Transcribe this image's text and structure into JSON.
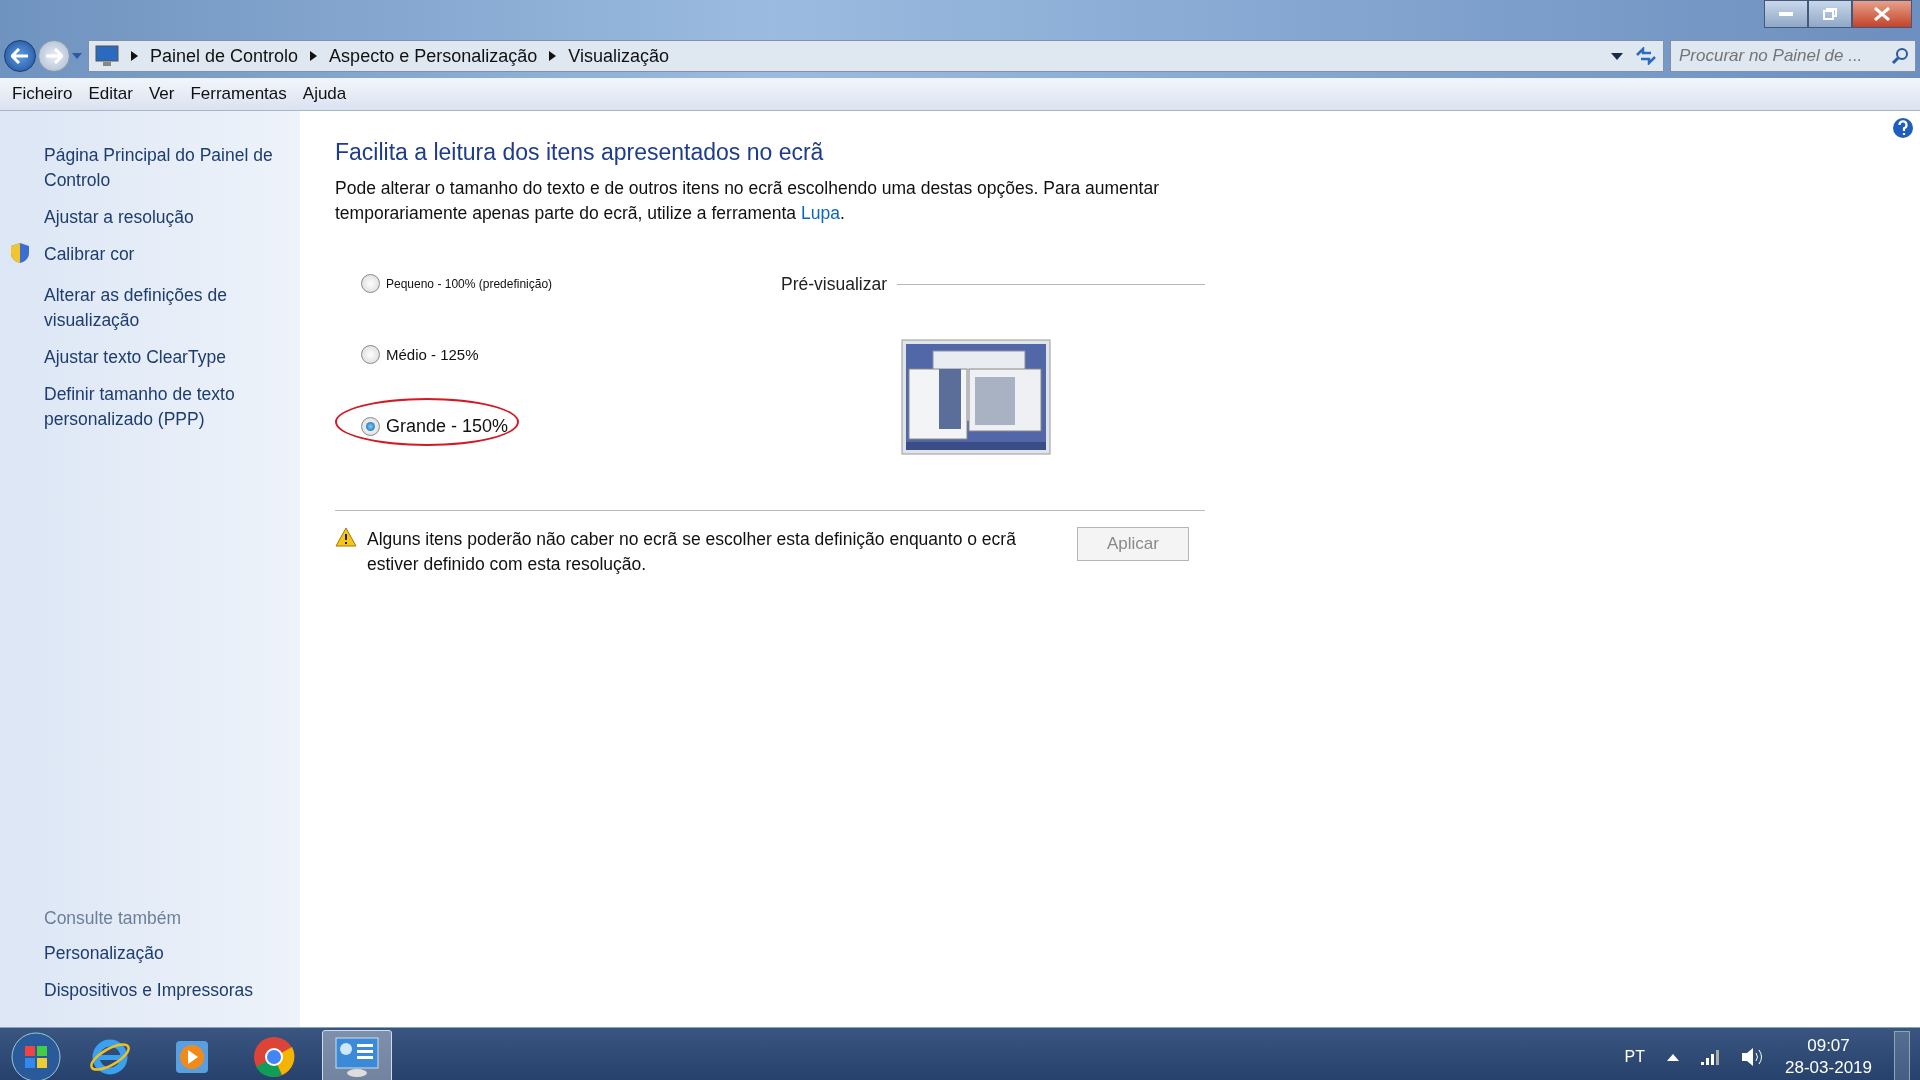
{
  "window": {
    "breadcrumb": [
      "Painel de Controlo",
      "Aspecto e Personalização",
      "Visualização"
    ],
    "search": {
      "placeholder": "Procurar no Painel de ..."
    }
  },
  "menu": [
    "Ficheiro",
    "Editar",
    "Ver",
    "Ferramentas",
    "Ajuda"
  ],
  "sidebar": {
    "items": [
      {
        "label": "Página Principal do Painel de Controlo",
        "shield": false
      },
      {
        "label": "Ajustar a resolução",
        "shield": false
      },
      {
        "label": "Calibrar cor",
        "shield": true
      },
      {
        "label": "Alterar as definições de visualização",
        "shield": false
      },
      {
        "label": "Ajustar texto ClearType",
        "shield": false
      },
      {
        "label": "Definir tamanho de texto personalizado (PPP)",
        "shield": false
      }
    ],
    "see_also": {
      "title": "Consulte também",
      "items": [
        "Personalização",
        "Dispositivos e Impressoras"
      ]
    }
  },
  "content": {
    "heading": "Facilita a leitura dos itens apresentados no ecrã",
    "description": "Pode alterar o tamanho do texto e de outros itens no ecrã escolhendo uma destas opções. Para aumentar temporariamente apenas parte do ecrã, utilize a ferramenta ",
    "link": "Lupa",
    "description_end": ".",
    "options": [
      {
        "label": "Pequeno - 100% (predefinição)",
        "kind": "small",
        "selected": false,
        "circled": false
      },
      {
        "label": "Médio - 125%",
        "kind": "medium",
        "selected": false,
        "circled": false
      },
      {
        "label": "Grande - 150%",
        "kind": "large",
        "selected": true,
        "circled": true
      }
    ],
    "preview_label": "Pré-visualizar",
    "warning": "Alguns itens poderão não caber no ecrã se escolher esta definição enquanto o ecrã estiver definido com esta resolução.",
    "apply": {
      "label": "Aplicar",
      "disabled": true
    }
  },
  "taskbar": {
    "language": "PT",
    "time": "09:07",
    "date": "28-03-2019"
  }
}
